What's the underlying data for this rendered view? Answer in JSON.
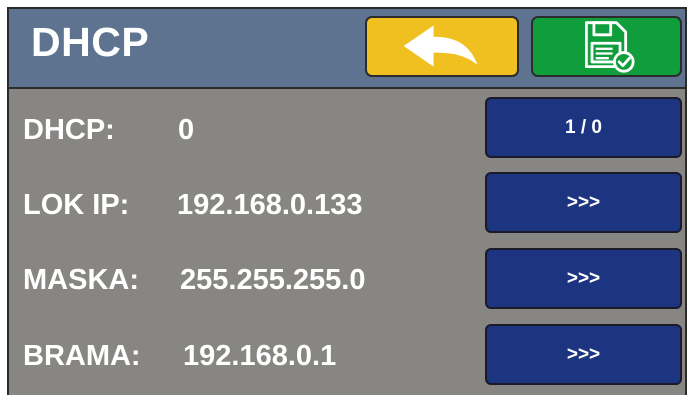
{
  "header": {
    "title": "DHCP",
    "back_icon": "back-arrow-icon",
    "save_icon": "save-disk-check-icon",
    "colors": {
      "header_bg": "#5d7390",
      "back_button": "#f0c020",
      "save_button": "#109e3c"
    }
  },
  "rows": [
    {
      "label": "DHCP:",
      "value": "0",
      "button": "1 / 0"
    },
    {
      "label": "LOK IP:",
      "value": "192.168.0.133",
      "button": ">>>"
    },
    {
      "label": "MASKA:",
      "value": "255.255.255.0",
      "button": ">>>"
    },
    {
      "label": "BRAMA:",
      "value": "192.168.0.1",
      "button": ">>>"
    }
  ],
  "colors": {
    "panel_bg": "#888683",
    "row_button": "#1d3481",
    "text": "#ffffff"
  }
}
